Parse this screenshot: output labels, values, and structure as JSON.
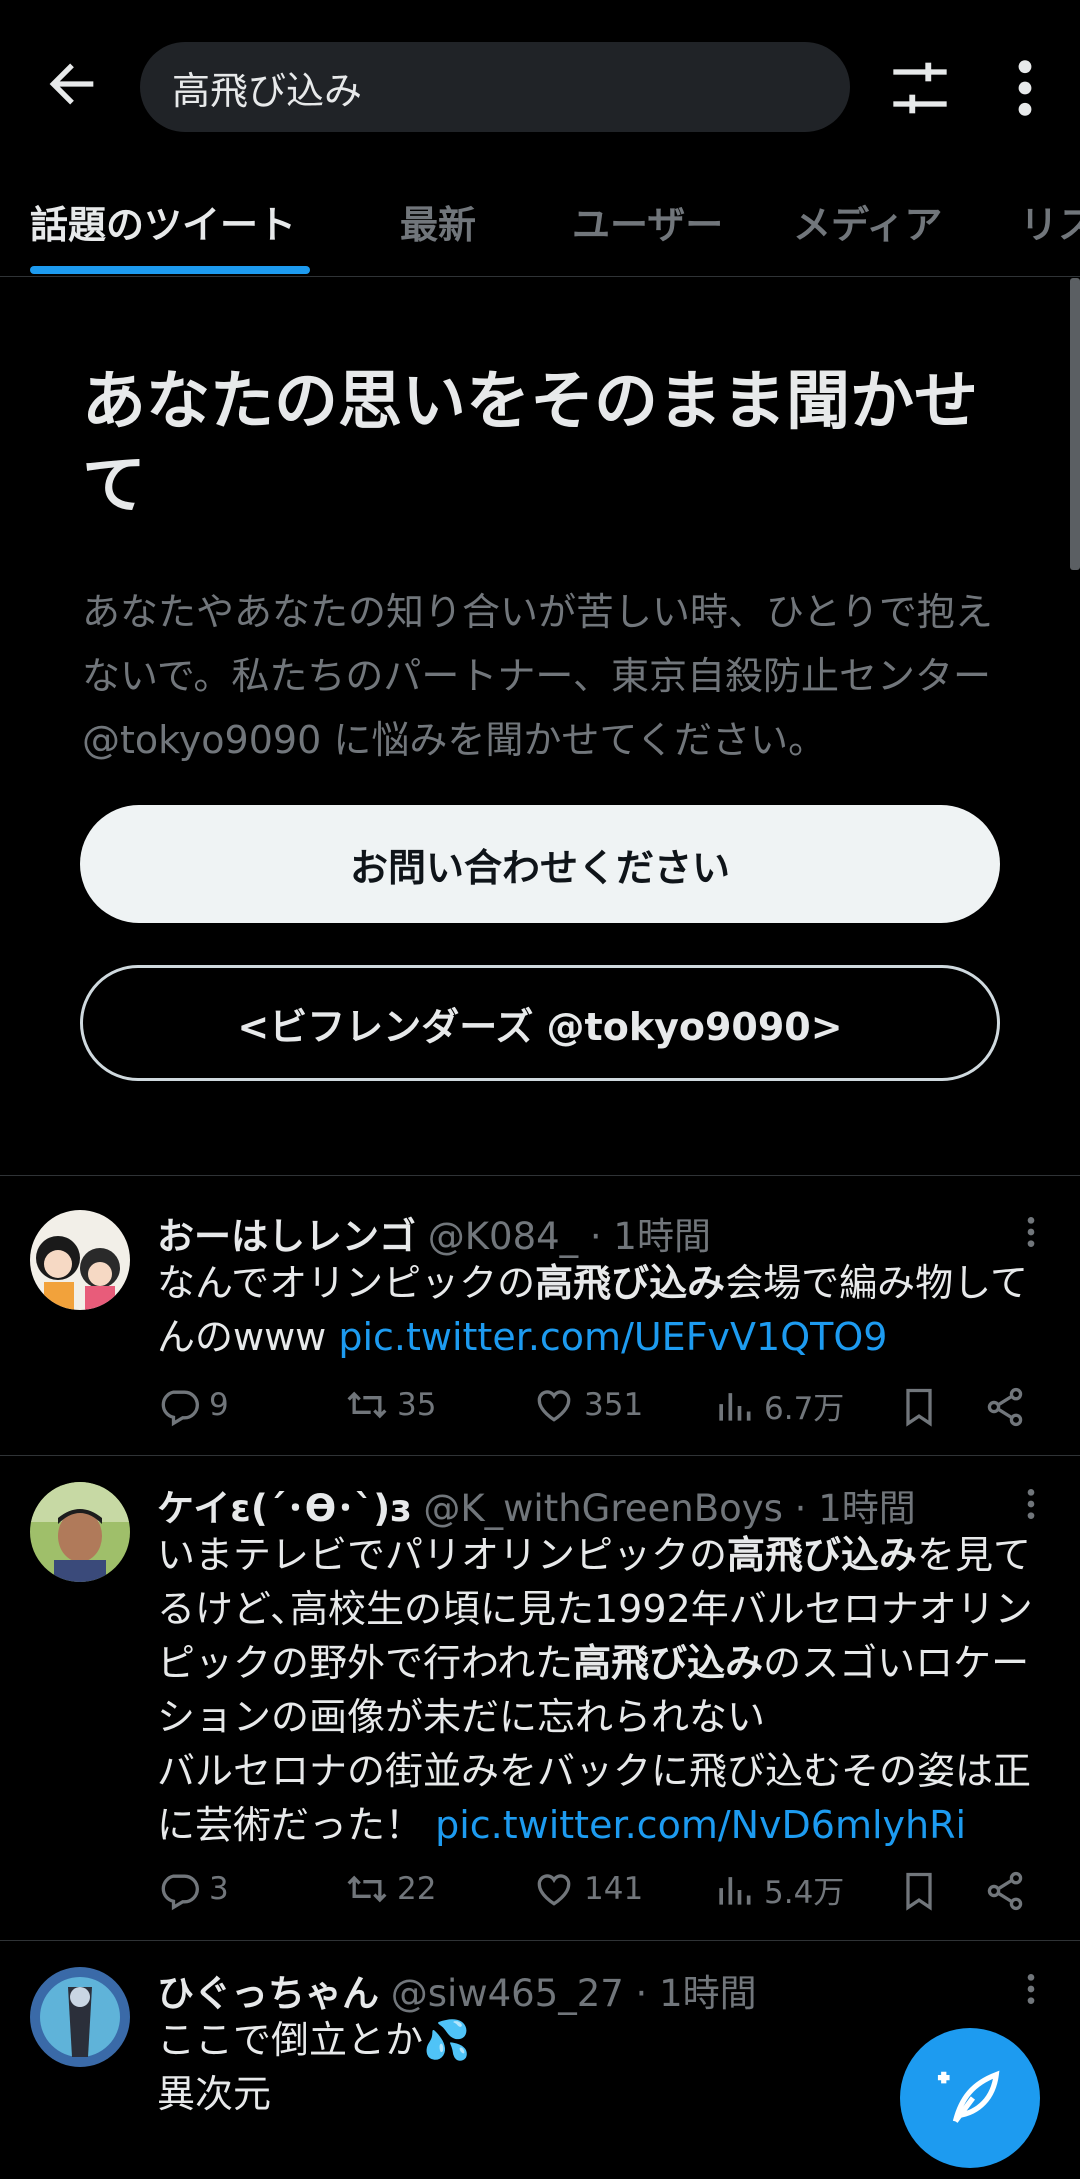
{
  "search": {
    "query": "高飛び込み"
  },
  "tabs": [
    "話題のツイート",
    "最新",
    "ユーザー",
    "メディア",
    "リス"
  ],
  "promo": {
    "title": "あなたの思いをそのまま聞かせて",
    "body": "あなたやあなたの知り合いが苦しい時、ひとりで抱えないで。私たちのパートナー、東京自殺防止センター @tokyo9090 に悩みを聞かせてください。",
    "primary_button": "お問い合わせください",
    "secondary_button": "<ビフレンダーズ @tokyo9090>"
  },
  "tweets": [
    {
      "name": "おーはしレンゴ",
      "meta": "@K084_ · 1時間",
      "text_1": "なんでオリンピックの",
      "text_bold_1": "高飛び込み",
      "text_2": "会場で編み物してんのwww ",
      "link": "pic.twitter.com/UEFvV1QTO9",
      "replies": "9",
      "retweets": "35",
      "likes": "351",
      "views": "6.7万"
    },
    {
      "name": "ケイε(´･ϴ･`)з",
      "meta": "@K_withGreenBoys · 1時間",
      "text_1": "いまテレビでパリオリンピックの",
      "text_bold_1": "高飛び込み",
      "text_2": "を見てるけど､高校生の頃に見た1992年バルセロナオリンピックの野外で行われた",
      "text_bold_2": "高飛び込み",
      "text_3": "のスゴいロケーションの画像が未だに忘れられない",
      "text_4": "バルセロナの街並みをバックに飛び込むその姿は正に芸術だった！ ",
      "link": "pic.twitter.com/NvD6mlyhRi",
      "replies": "3",
      "retweets": "22",
      "likes": "141",
      "views": "5.4万"
    },
    {
      "name": "ひぐっちゃん",
      "meta": "@siw465_27 · 1時間",
      "line_1": "ここで倒立とか💦",
      "line_2": "異次元"
    }
  ]
}
